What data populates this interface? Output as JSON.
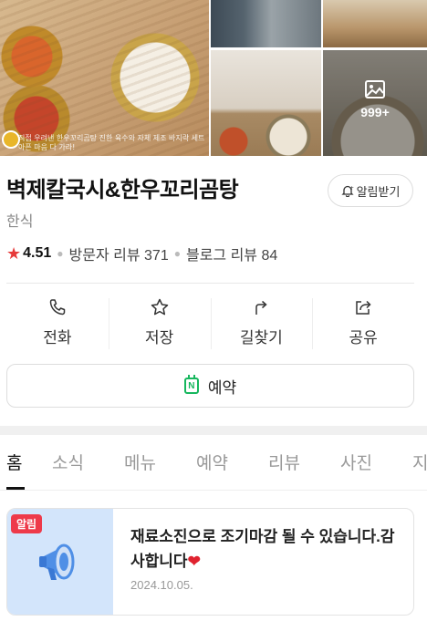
{
  "photos": {
    "more_count": "999+",
    "main_caption": "직접 우려낸 한우꼬리곰탕 진한 육수와 자체 제조 바지락 세트 아픈 마음 다 가라!"
  },
  "place": {
    "name": "벽제칼국시&한우꼬리곰탕",
    "category": "한식",
    "alert_label": "알림받기",
    "rating": "4.51",
    "visitor_reviews": "방문자 리뷰 371",
    "blog_reviews": "블로그 리뷰 84"
  },
  "actions": [
    {
      "label": "전화",
      "icon": "phone-icon"
    },
    {
      "label": "저장",
      "icon": "star-icon"
    },
    {
      "label": "길찾기",
      "icon": "directions-icon"
    },
    {
      "label": "공유",
      "icon": "share-icon"
    }
  ],
  "reserve": {
    "label": "예약",
    "icon_letter": "N"
  },
  "tabs": [
    {
      "label": "홈",
      "active": true
    },
    {
      "label": "소식",
      "active": false
    },
    {
      "label": "메뉴",
      "active": false
    },
    {
      "label": "예약",
      "active": false
    },
    {
      "label": "리뷰",
      "active": false
    },
    {
      "label": "사진",
      "active": false
    },
    {
      "label": "지도",
      "active": false
    }
  ],
  "notice": {
    "badge": "알림",
    "text": "재료소진으로 조기마감 될 수 있습니다.감사합니다",
    "heart": "❤",
    "date": "2024.10.05."
  },
  "colors": {
    "accent_red": "#e63a3a",
    "naver_green": "#17b75e"
  }
}
